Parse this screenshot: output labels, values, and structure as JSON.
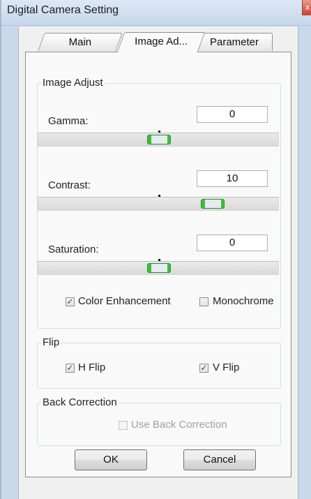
{
  "window": {
    "title": "Digital Camera Setting",
    "close_glyph": "x"
  },
  "tabs": [
    {
      "label": "Main"
    },
    {
      "label": "Image Ad..."
    },
    {
      "label": "Parameter"
    }
  ],
  "image_adjust": {
    "group_title": "Image Adjust",
    "sliders": [
      {
        "label": "Gamma:",
        "value": "0",
        "slider_position": 0.5
      },
      {
        "label": "Contrast:",
        "value": "10",
        "slider_position": 0.71
      },
      {
        "label": "Saturation:",
        "value": "0",
        "slider_position": 0.5
      }
    ],
    "color_enhancement": {
      "label": "Color Enhancement",
      "checked": true
    },
    "monochrome": {
      "label": "Monochrome",
      "checked": false
    }
  },
  "flip": {
    "group_title": "Flip",
    "h_flip": {
      "label": "H Flip",
      "checked": true
    },
    "v_flip": {
      "label": "V Flip",
      "checked": true
    }
  },
  "back_correction": {
    "group_title": "Back Correction",
    "use_back_correction": {
      "label": "Use Back Correction",
      "checked": false,
      "enabled": false
    }
  },
  "buttons": {
    "ok": "OK",
    "cancel": "Cancel"
  },
  "checkmark": "✓"
}
